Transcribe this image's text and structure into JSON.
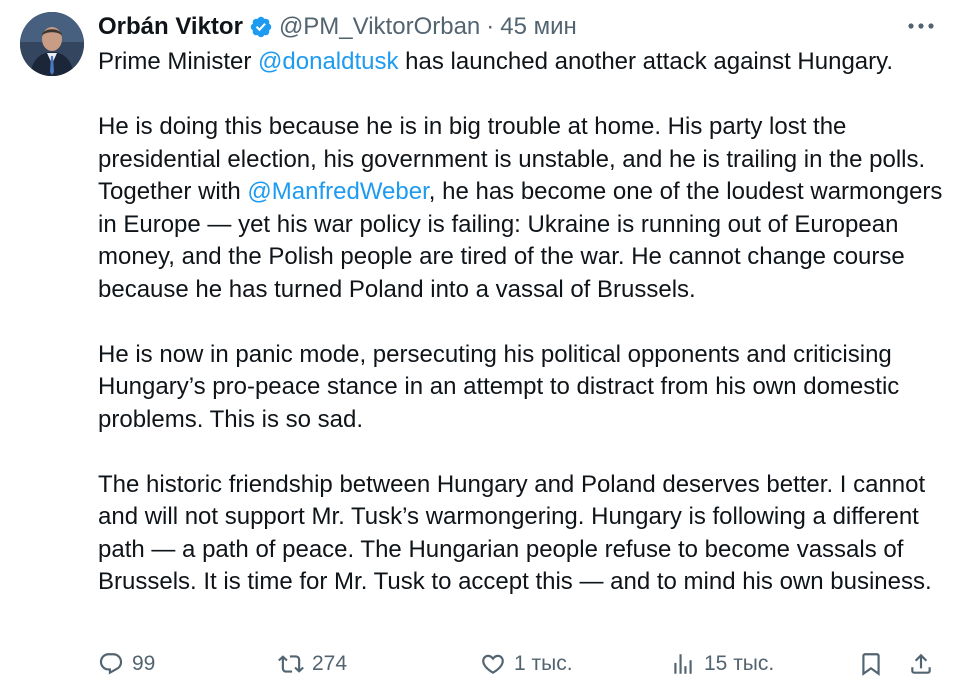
{
  "author": {
    "name": "Orbán Viktor",
    "handle": "@PM_ViktorOrban",
    "separator": "·",
    "time": "45 мин"
  },
  "icons": {
    "verified": "verified-badge-icon",
    "more": "more-dots-icon",
    "reply": "reply-icon",
    "repost": "repost-icon",
    "like": "heart-icon",
    "views": "views-chart-icon",
    "bookmark": "bookmark-icon",
    "share": "share-icon"
  },
  "colors": {
    "link": "#1d9bf0",
    "verified": "#1d9bf0",
    "secondary_text": "#536471",
    "text": "#0f1419"
  },
  "tweet": {
    "p1": {
      "before": "Prime Minister ",
      "mention": "@donaldtusk",
      "after": " has launched another attack against Hungary."
    },
    "p2": {
      "before": "He is doing this because he is in big trouble at home. His party lost the presidential election, his government is unstable, and he is trailing in the polls. Together with ",
      "mention": "@ManfredWeber",
      "after": ", he has become one of the loudest warmongers in Europe — yet his war policy is failing: Ukraine is running out of European money, and the Polish people are tired of the war. He cannot change course because he has turned Poland into a vassal of Brussels."
    },
    "p3": "He is now in panic mode, persecuting his political opponents and criticising Hungary’s pro-peace stance in an attempt to distract from his own domestic problems. This is so sad.",
    "p4": "The historic friendship between Hungary and Poland deserves better. I cannot and will not support Mr. Tusk’s warmongering. Hungary is following a different path — a path of peace. The Hungarian people refuse to become vassals of Brussels. It is time for Mr. Tusk to accept this — and to mind his own business."
  },
  "actions": {
    "replies": "99",
    "reposts": "274",
    "likes": "1 тыс.",
    "views": "15 тыс."
  }
}
